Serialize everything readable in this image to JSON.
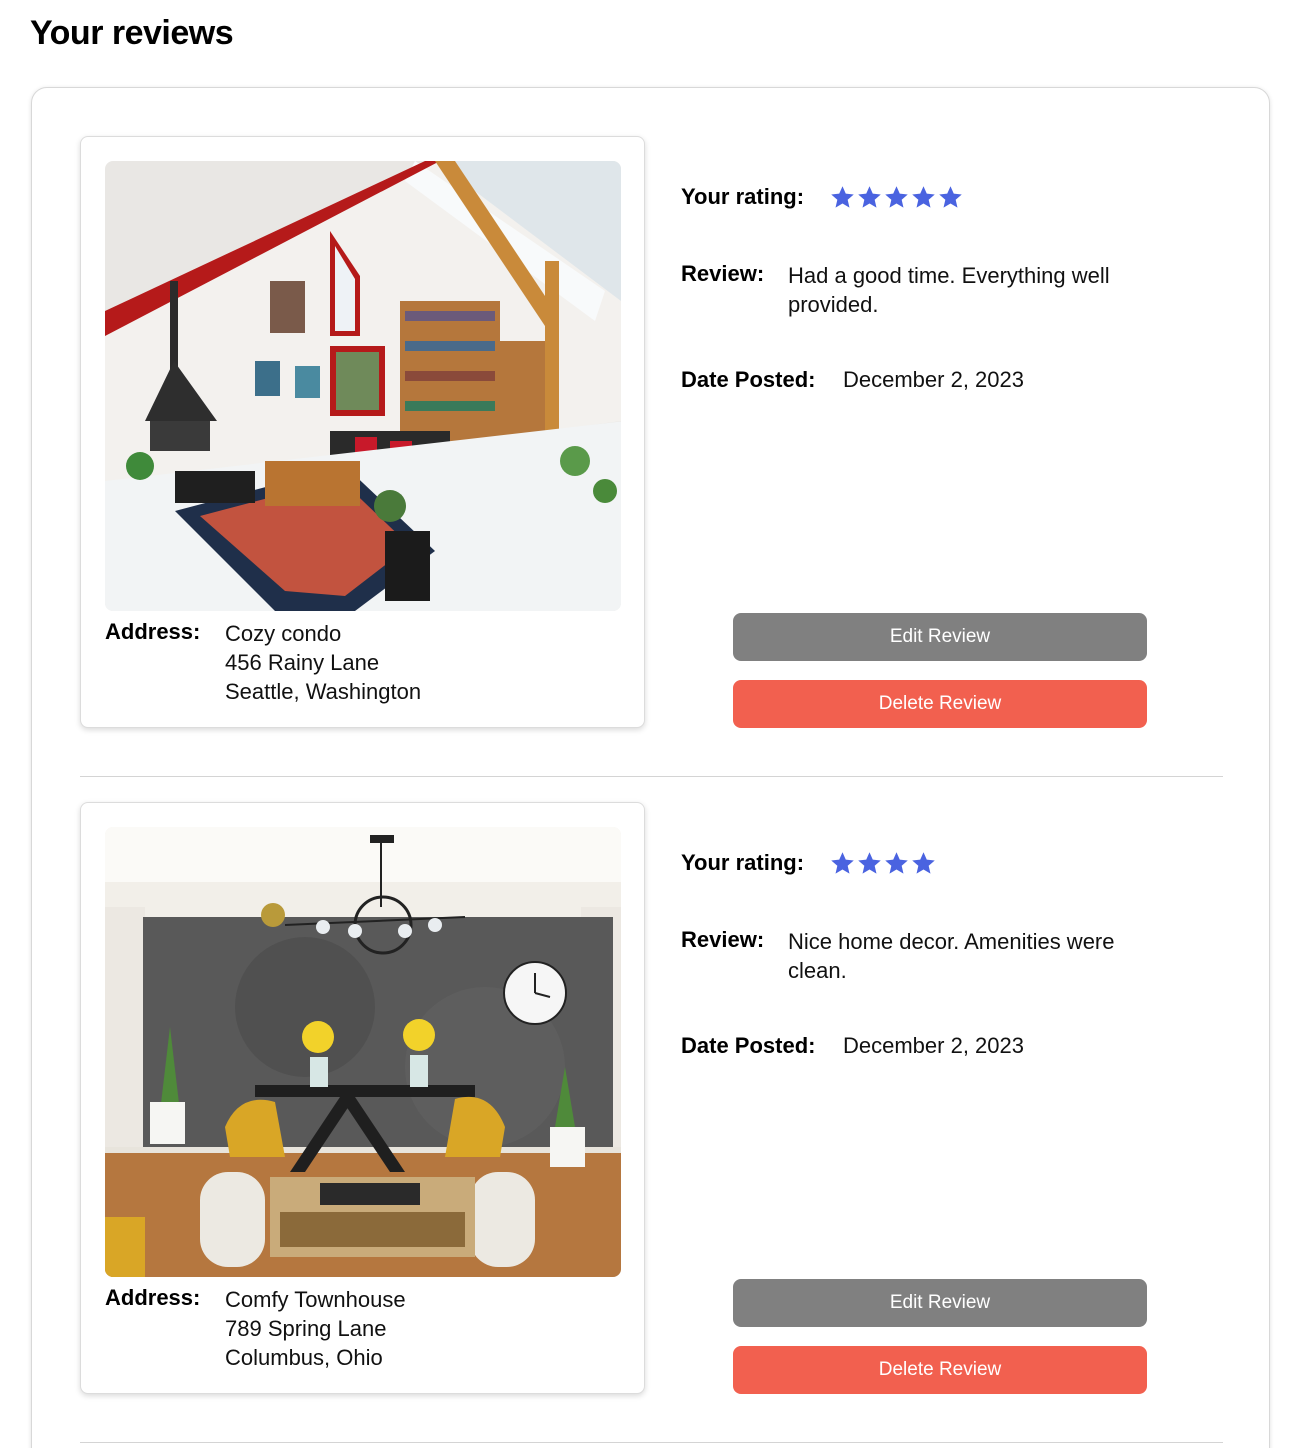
{
  "page": {
    "title": "Your reviews"
  },
  "labels": {
    "rating": "Your rating:",
    "review": "Review:",
    "date": "Date Posted:",
    "address": "Address:",
    "edit_button": "Edit Review",
    "delete_button": "Delete Review"
  },
  "colors": {
    "star": "#4a63e0",
    "edit_button": "#808080",
    "delete_button": "#f2604f"
  },
  "reviews": [
    {
      "rating": 5,
      "text": "Had a good time. Everything well provided.",
      "date": "December 2, 2023",
      "address": {
        "name": "Cozy condo",
        "street": "456 Rainy Lane",
        "city": "Seattle, Washington"
      },
      "photo": "living-room-photo"
    },
    {
      "rating": 4,
      "text": "Nice home decor. Amenities were clean.",
      "date": "December 2, 2023",
      "address": {
        "name": "Comfy Townhouse",
        "street": "789 Spring Lane",
        "city": "Columbus, Ohio"
      },
      "photo": "dining-room-photo"
    }
  ]
}
